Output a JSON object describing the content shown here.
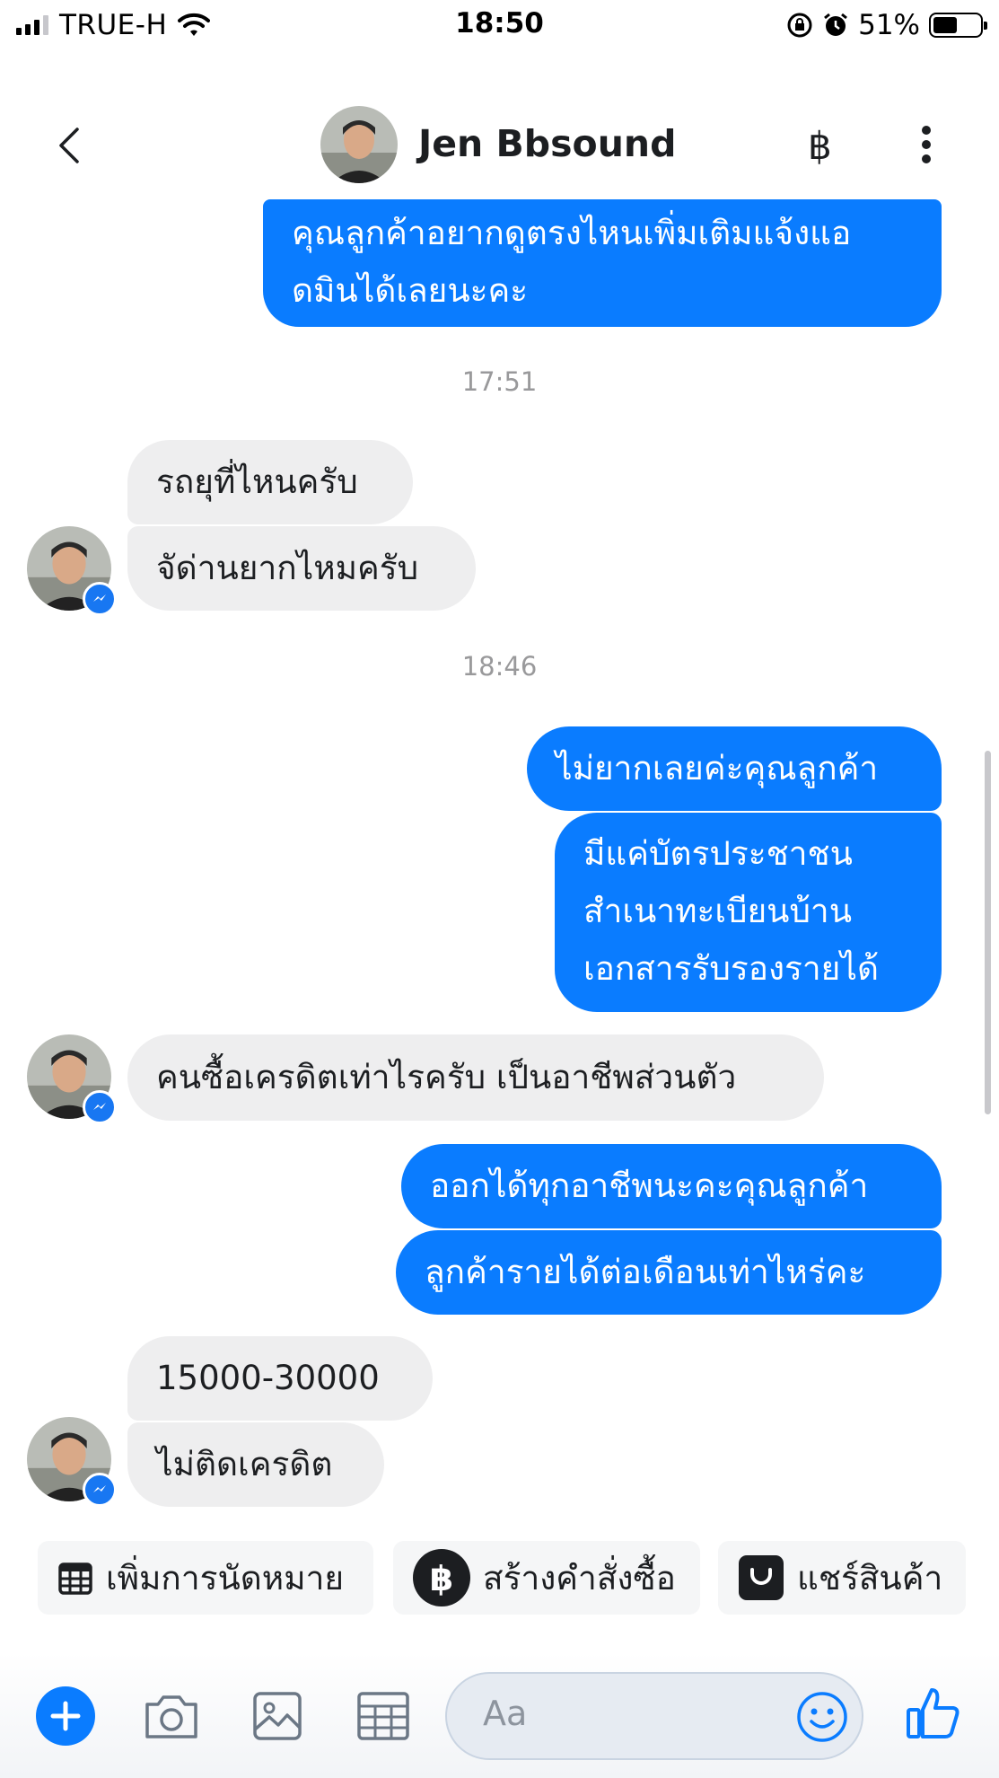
{
  "status_bar": {
    "carrier": "TRUE-H",
    "time": "18:50",
    "battery": "51%",
    "battery_level": 0.51
  },
  "header": {
    "contact_name": "Jen Bbsound",
    "baht_symbol": "฿"
  },
  "messages": {
    "out_1": "คุณลูกค้าอยากดูตรงไหนเพิ่มเติมแจ้งแอ\nดมินได้เลยนะคะ",
    "time_1": "17:51",
    "in_1": "รถยุที่ไหนครับ",
    "in_2": "จัด่านยากไหมครับ",
    "time_2": "18:46",
    "out_2": "ไม่ยากเลยค่ะคุณลูกค้า",
    "out_3": "มีแค่บัตรประชาชน\nสำเนาทะเบียนบ้าน\nเอกสารรับรองรายได้",
    "in_3": "คนซื้อเครดิตเท่าไรครับ เป็นอาชีพส่วนตัว",
    "out_4": "ออกได้ทุกอาชีพนะคะคุณลูกค้า",
    "out_5": "ลูกค้ารายได้ต่อเดือนเท่าไหร่คะ",
    "in_4": "15000-30000",
    "in_5": "ไม่ติดเครดิต"
  },
  "quick_actions": {
    "appointment": "เพิ่มการนัดหมาย",
    "order": "สร้างคำสั่งซื้อ",
    "share_product": "แชร์สินค้า"
  },
  "composer": {
    "placeholder": "Aa"
  },
  "icons": [
    "signal-icon",
    "wifi-icon",
    "lock-rotation-icon",
    "alarm-icon",
    "battery-icon",
    "back-icon",
    "baht-icon",
    "more-icon",
    "messenger-badge-icon",
    "calendar-icon",
    "shopping-bag-icon",
    "plus-icon",
    "camera-icon",
    "image-icon",
    "template-icon",
    "emoji-icon",
    "like-icon"
  ],
  "colors": {
    "accent": "#0a7cff",
    "incoming_bubble": "#eeeeef",
    "timestamp": "#99999b"
  }
}
